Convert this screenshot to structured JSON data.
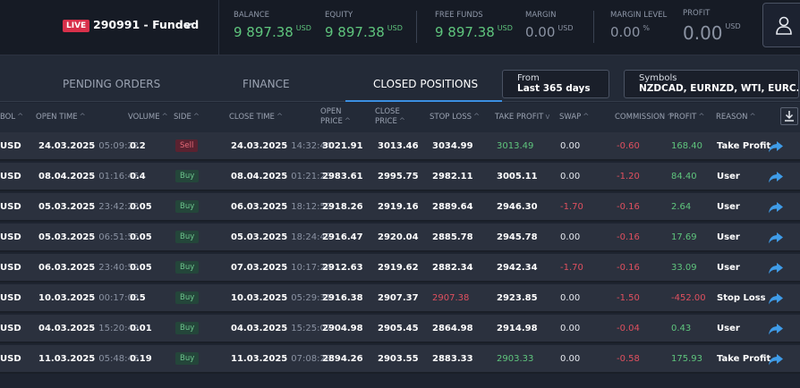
{
  "account": {
    "live_label": "LIVE",
    "name": "290991 - Funded"
  },
  "metrics": [
    {
      "label": "BALANCE",
      "value": "9 897.38",
      "unit": "USD"
    },
    {
      "label": "EQUITY",
      "value": "9 897.38",
      "unit": "USD"
    },
    {
      "label": "FREE FUNDS",
      "value": "9 897.38",
      "unit": "USD"
    },
    {
      "label": "MARGIN",
      "value": "0.00",
      "unit": "USD"
    },
    {
      "label": "MARGIN LEVEL",
      "value": "0.00",
      "unit": "%"
    },
    {
      "label": "PROFIT",
      "value": "0.00",
      "unit": "USD"
    }
  ],
  "tabs": [
    {
      "label": "PENDING ORDERS"
    },
    {
      "label": "FINANCE"
    },
    {
      "label": "CLOSED POSITIONS",
      "active": true
    }
  ],
  "filters": {
    "from_label": "From",
    "from_value": "Last 365 days",
    "symbols_label": "Symbols",
    "symbols_value": "NZDCAD, EURNZD, WTI, EURC..."
  },
  "columns": {
    "symbol": "BOL",
    "open_time": "OPEN TIME",
    "volume": "VOLUME",
    "side": "SIDE",
    "close_time": "CLOSE TIME",
    "open_price_1": "OPEN",
    "open_price_2": "PRICE",
    "close_price_1": "CLOSE",
    "close_price_2": "PRICE",
    "stop_loss": "STOP LOSS",
    "take_profit": "TAKE PROFIT",
    "swap": "SWAP",
    "commission": "COMMISSION",
    "profit": "PROFIT",
    "reason": "REASON"
  },
  "rows": [
    {
      "symbol": "USD",
      "open_date": "24.03.2025",
      "open_time": "05:09:22",
      "volume": "0.2",
      "side": "Sell",
      "close_date": "24.03.2025",
      "close_time": "14:32:44",
      "open_price": "3021.91",
      "close_price": "3013.46",
      "stop_loss": "3034.99",
      "take_profit": "3013.49",
      "tp_green": true,
      "sl_red": false,
      "swap": "0.00",
      "commission": "-0.60",
      "profit": "168.40",
      "reason": "Take Profit"
    },
    {
      "symbol": "USD",
      "open_date": "08.04.2025",
      "open_time": "01:16:46",
      "volume": "0.4",
      "side": "Buy",
      "close_date": "08.04.2025",
      "close_time": "01:21:23",
      "open_price": "2983.61",
      "close_price": "2995.75",
      "stop_loss": "2982.11",
      "take_profit": "3005.11",
      "tp_green": false,
      "sl_red": false,
      "swap": "0.00",
      "commission": "-1.20",
      "profit": "84.40",
      "reason": "User"
    },
    {
      "symbol": "USD",
      "open_date": "05.03.2025",
      "open_time": "23:42:28",
      "volume": "0.05",
      "side": "Buy",
      "close_date": "06.03.2025",
      "close_time": "18:12:52",
      "open_price": "2918.26",
      "close_price": "2919.16",
      "stop_loss": "2889.64",
      "take_profit": "2946.30",
      "tp_green": false,
      "sl_red": false,
      "swap": "-1.70",
      "commission": "-0.16",
      "profit": "2.64",
      "reason": "User"
    },
    {
      "symbol": "USD",
      "open_date": "05.03.2025",
      "open_time": "06:51:56",
      "volume": "0.05",
      "side": "Buy",
      "close_date": "05.03.2025",
      "close_time": "18:24:47",
      "open_price": "2916.47",
      "close_price": "2920.04",
      "stop_loss": "2885.78",
      "take_profit": "2945.78",
      "tp_green": false,
      "sl_red": false,
      "swap": "0.00",
      "commission": "-0.16",
      "profit": "17.69",
      "reason": "User"
    },
    {
      "symbol": "USD",
      "open_date": "06.03.2025",
      "open_time": "23:40:59",
      "volume": "0.05",
      "side": "Buy",
      "close_date": "07.03.2025",
      "close_time": "10:17:24",
      "open_price": "2912.63",
      "close_price": "2919.62",
      "stop_loss": "2882.34",
      "take_profit": "2942.34",
      "tp_green": false,
      "sl_red": false,
      "swap": "-1.70",
      "commission": "-0.16",
      "profit": "33.09",
      "reason": "User"
    },
    {
      "symbol": "USD",
      "open_date": "10.03.2025",
      "open_time": "00:17:03",
      "volume": "0.5",
      "side": "Buy",
      "close_date": "10.03.2025",
      "close_time": "05:29:31",
      "open_price": "2916.38",
      "close_price": "2907.37",
      "stop_loss": "2907.38",
      "take_profit": "2923.85",
      "tp_green": false,
      "sl_red": true,
      "swap": "0.00",
      "commission": "-1.50",
      "profit": "-452.00",
      "reason": "Stop Loss"
    },
    {
      "symbol": "USD",
      "open_date": "04.03.2025",
      "open_time": "15:20:49",
      "volume": "0.01",
      "side": "Buy",
      "close_date": "04.03.2025",
      "close_time": "15:25:07",
      "open_price": "2904.98",
      "close_price": "2905.45",
      "stop_loss": "2864.98",
      "take_profit": "2914.98",
      "tp_green": false,
      "sl_red": false,
      "swap": "0.00",
      "commission": "-0.04",
      "profit": "0.43",
      "reason": "User"
    },
    {
      "symbol": "USD",
      "open_date": "11.03.2025",
      "open_time": "05:48:46",
      "volume": "0.19",
      "side": "Buy",
      "close_date": "11.03.2025",
      "close_time": "07:08:28",
      "open_price": "2894.26",
      "close_price": "2903.55",
      "stop_loss": "2883.33",
      "take_profit": "2903.33",
      "tp_green": true,
      "sl_red": false,
      "swap": "0.00",
      "commission": "-0.58",
      "profit": "175.93",
      "reason": "Take Profit"
    }
  ]
}
